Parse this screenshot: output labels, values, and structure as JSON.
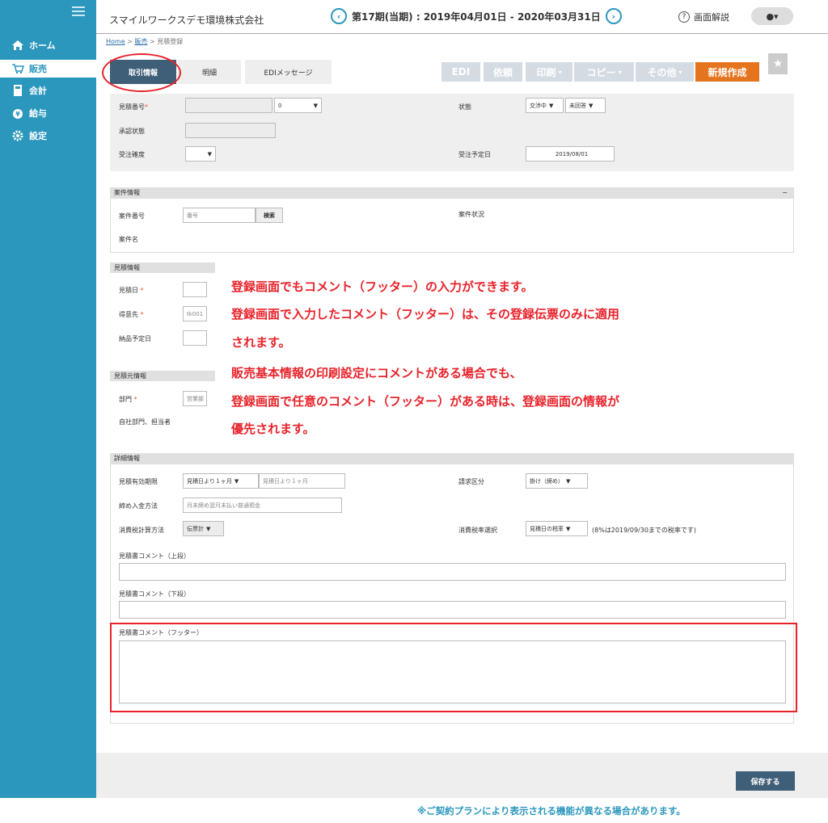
{
  "sidebar": {
    "items": [
      {
        "label": "ホーム",
        "icon": "home-icon"
      },
      {
        "label": "販売",
        "icon": "cart-icon"
      },
      {
        "label": "会計",
        "icon": "calculator-icon"
      },
      {
        "label": "給与",
        "icon": "money-bag-icon"
      },
      {
        "label": "設定",
        "icon": "gear-icon"
      }
    ]
  },
  "header": {
    "company": "スマイルワークスデモ環境株式会社",
    "period": "第17期(当期) : 2019年04月01日 - 2020年03月31日",
    "help": "画面解説"
  },
  "breadcrumb": {
    "home": "Home",
    "sales": "販売",
    "current": "見積登録"
  },
  "tabs": [
    "取引情報",
    "明細",
    "EDIメッセージ"
  ],
  "toolbar": {
    "edi": "EDI",
    "request": "依頼",
    "print": "印刷",
    "copy": "コピー",
    "other": "その他",
    "new": "新規作成"
  },
  "top_form": {
    "estimate_no_label": "見積番号",
    "estimate_no_value": "0",
    "approval_label": "承認状態",
    "order_prob_label": "受注確度",
    "status_label": "状態",
    "status_value1": "交渉中",
    "status_value2": "未回答",
    "order_date_label": "受注予定日",
    "order_date_value": "2019/08/01"
  },
  "case_section": {
    "title": "案件情報",
    "case_no_label": "案件番号",
    "case_no_placeholder": "番号",
    "search": "検索",
    "case_status_label": "案件状況",
    "case_name_label": "案件名",
    "collapse": "−"
  },
  "estimate_section": {
    "title": "見積情報",
    "date_label": "見積日",
    "customer_label": "得意先",
    "customer_value": "tk001",
    "delivery_label": "納品予定日"
  },
  "source_section": {
    "title": "見積元情報",
    "dept_label": "部門",
    "dept_value": "営業部",
    "own_label": "自社部門、担当者"
  },
  "detail_section": {
    "title": "詳細情報",
    "validity_label": "見積有効期限",
    "validity_value1": "見積日より１ヶ月",
    "validity_value2": "見積日より１ヶ月",
    "billing_label": "請求区分",
    "billing_value": "掛け（締め）",
    "payment_label": "締め入金方法",
    "payment_value": "月末締め翌月末払い普通預金",
    "tax_calc_label": "消費税計算方法",
    "tax_calc_value": "伝票計",
    "tax_rate_label": "消費税率選択",
    "tax_rate_value": "見積日の税率",
    "tax_note": "(8%は2019/09/30までの税率です)",
    "comment_top_label": "見積書コメント（上段）",
    "comment_bottom_label": "見積書コメント（下段）",
    "comment_footer_label": "見積書コメント（フッター）"
  },
  "callout": [
    "登録画面でもコメント（フッター）の入力ができます。",
    "登録画面で入力したコメント（フッター）は、その登録伝票のみに適用",
    "されます。",
    "販売基本情報の印刷設定にコメントがある場合でも、",
    "登録画面で任意のコメント（フッター）がある時は、登録画面の情報が",
    "優先されます。"
  ],
  "save": "保存する",
  "footnote": "※ご契約プランにより表示される機能が異なる場合があります。",
  "colors": {
    "accent": "#2b97bd",
    "highlight": "#e8232b",
    "primary_button": "#e5741f"
  }
}
